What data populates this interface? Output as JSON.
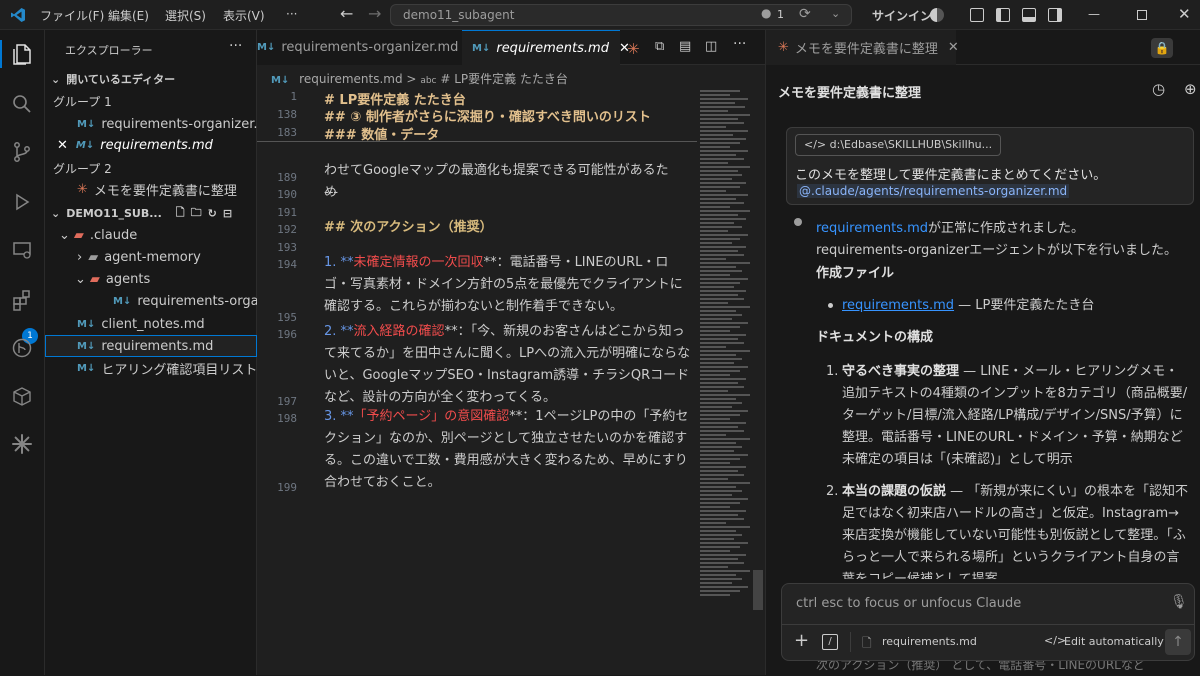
{
  "titlebar": {
    "menus": [
      "ファイル(F)",
      "編集(E)",
      "選択(S)",
      "表示(V)",
      "···"
    ],
    "search_text": "demo11_subagent",
    "badge_count": "1",
    "signin": "サインイン"
  },
  "activity_bar": {
    "extensions_badge": "1"
  },
  "sidebar": {
    "title": "エクスプローラー",
    "open_editors_header": "開いているエディター",
    "group1": "グループ 1",
    "group1_file": "requirements-organizer.md",
    "group1_active": "requirements.md",
    "group2": "グループ 2",
    "group2_item": "メモを要件定義書に整理",
    "folder_header": "DEMO11_SUB...",
    "tree": {
      "claude": ".claude",
      "agent_memory": "agent-memory",
      "agents": "agents",
      "agents_file": "requirements-orga...",
      "client_notes": "client_notes.md",
      "requirements": "requirements.md",
      "hearing": "ヒアリング確認項目リスト.md"
    }
  },
  "editor": {
    "tabs": [
      {
        "label": "requirements-organizer.md"
      },
      {
        "label": "requirements.md"
      }
    ],
    "breadcrumb": {
      "file": "requirements.md",
      "sep": ">",
      "abc": "abc",
      "section": "# LP要件定義 たたき台"
    },
    "sticky": [
      {
        "ln": "1",
        "text": "# LP要件定義 たたき台"
      },
      {
        "ln": "138",
        "text": "## ③ 制作者がさらに深掘り・確認すべき問いのリスト"
      },
      {
        "ln": "183",
        "text": "### 数値・データ"
      }
    ],
    "lines": {
      "partial": "わせてGoogleマップの最適化も提案できる可能性があるた",
      "partial2": "め",
      "ln189": "189",
      "ln190": "190",
      "dashes": "---",
      "ln191": "191",
      "ln192": "192",
      "next_action": "## 次のアクション（推奨）",
      "ln193": "193",
      "ln194": "194",
      "item1_prefix": "1. **",
      "item1_red": "未確定情報の一次回収",
      "item1_rest": "**：電話番号・LINEのURL・ロゴ・写真素材・ドメイン方針の5点を最優先でクライアントに確認する。これらが揃わないと制作着手できない。",
      "ln195": "195",
      "ln196": "196",
      "item2_prefix": "2. **",
      "item2_red": "流入経路の確認",
      "item2_rest": "**：「今、新規のお客さんはどこから知って来てるか」を田中さんに聞く。LPへの流入元が明確にならないと、GoogleマップSEO・Instagram誘導・チラシQRコードなど、設計の方向が全く変わってくる。",
      "ln197": "197",
      "ln198": "198",
      "item3_prefix": "3. **",
      "item3_red": "「予約ページ」の意図確認",
      "item3_rest": "**：1ページLPの中の「予約セクション」なのか、別ページとして独立させたいのかを確認する。この違いで工数・費用感が大きく変わるため、早めにすり合わせておくこと。",
      "ln199": "199"
    }
  },
  "panel": {
    "tab_label": "メモを要件定義書に整理",
    "header": "メモを要件定義書に整理",
    "context_chip": "d:\\Edbase\\SKILLHUB\\Skillhu...",
    "user_message": "このメモを整理して要件定義書にまとめてください。",
    "user_mention": "@.claude/agents/requirements-organizer.md",
    "reply_link1": "requirements.md",
    "reply_line1": "が正常に作成されました。",
    "reply_line2": "requirements-organizerエージェントが以下を行いました。",
    "created_files": "作成ファイル",
    "file_link": "requirements.md",
    "file_desc": " — LP要件定義たたき台",
    "doc_structure": "ドキュメントの構成",
    "item1_title": "守るべき事実の整理",
    "item1_body": " — LINE・メール・ヒアリングメモ・追加テキストの4種類のインプットを8カテゴリ（商品概要/ターゲット/目標/流入経路/LP構成/デザイン/SNS/予算）に整理。電話番号・LINEのURL・ドメイン・予算・納期など未確定の項目は「(未確認)」として明示",
    "item2_title": "本当の課題の仮説",
    "item2_body": " — 「新規が来にくい」の根本を「認知不足ではなく初来店ハードルの高さ」と仮定。Instagram→来店変換が機能していない可能性も別仮説として整理。「ふらっと一人で来られる場所」というクライアント自身の言葉をコピー候補として提案",
    "hidden_tail": "次のアクション（推奨） として、電話番号・LINEのURLなど",
    "input_placeholder": "ctrl esc to focus or unfocus Claude",
    "input_file": "requirements.md",
    "edit_mode": "Edit automatically"
  },
  "colors": {
    "accent": "#0078d4",
    "claude_orange": "#d97757",
    "heading_gold": "#e2c08d",
    "emphasis_red": "#f14c4c",
    "link_blue": "#3794ff"
  }
}
